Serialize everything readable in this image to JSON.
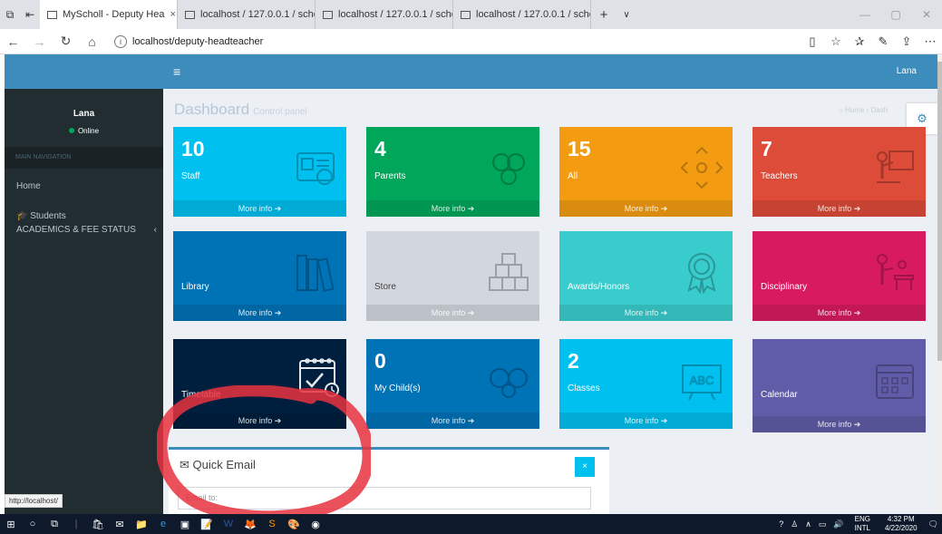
{
  "browser": {
    "tabs": [
      {
        "title": "MyScholl - Deputy Hea",
        "close": "×"
      },
      {
        "title": "localhost / 127.0.0.1 / schoc"
      },
      {
        "title": "localhost / 127.0.0.1 / schoc"
      },
      {
        "title": "localhost / 127.0.0.1 / schoc"
      }
    ],
    "new_tab": "+",
    "tab_menu": "∨",
    "window_controls": [
      "—",
      "▢",
      "✕"
    ],
    "nav": {
      "back": "←",
      "forward": "→",
      "refresh": "↻",
      "home": "⌂"
    },
    "url_info": "i",
    "url": "localhost/deputy-headteacher",
    "addr_icons": [
      "▯",
      "☆",
      "✰",
      "✎",
      "⇪",
      "⋯"
    ]
  },
  "app": {
    "hamburger": "≡",
    "top_user": "Lana",
    "sidebar": {
      "user_name": "Lana",
      "status": "Online",
      "header": "MAIN NAVIGATION",
      "items": [
        {
          "label": "Home"
        },
        {
          "label": "Students",
          "icon": "graduation-cap-icon"
        },
        {
          "label": "ACADEMICS & FEE STATUS",
          "chevron": "‹"
        }
      ]
    },
    "content": {
      "title": "Dashboard",
      "subtitle": "Control panel",
      "breadcrumb": "Home › Dash"
    },
    "boxes": [
      {
        "num": "10",
        "label": "Staff",
        "more": "More info ➔",
        "color": "#00c0ef",
        "icon": "id-card-icon"
      },
      {
        "num": "4",
        "label": "Parents",
        "more": "More info ➔",
        "color": "#00a65a",
        "icon": "family-icon"
      },
      {
        "num": "15",
        "label": "All",
        "more": "More info ➔",
        "color": "#f39c12",
        "icon": "arrows-icon"
      },
      {
        "num": "7",
        "label": "Teachers",
        "more": "More info ➔",
        "color": "#dd4b39",
        "icon": "teacher-icon"
      },
      {
        "num": "",
        "label": "Library",
        "more": "More info ➔",
        "color": "#0073b7",
        "icon": "books-icon"
      },
      {
        "num": "",
        "label": "Store",
        "more": "More info ➔",
        "color": "#d2d6de",
        "icon": "boxes-icon"
      },
      {
        "num": "",
        "label": "Awards/Honors",
        "more": "More info ➔",
        "color": "#39cccc",
        "icon": "award-icon"
      },
      {
        "num": "",
        "label": "Disciplinary",
        "more": "More info ➔",
        "color": "#d81b60",
        "icon": "discipline-icon"
      },
      {
        "num": "",
        "label": "Timetable",
        "more": "More info ➔",
        "color": "#001f3f",
        "icon": "calendar-check-icon"
      },
      {
        "num": "0",
        "label": "My Child(s)",
        "more": "More info ➔",
        "color": "#0073b7",
        "icon": "children-icon"
      },
      {
        "num": "2",
        "label": "Classes",
        "more": "More info ➔",
        "color": "#00c0ef",
        "icon": "abc-board-icon"
      },
      {
        "num": "",
        "label": "Calendar",
        "more": "More info ➔",
        "color": "#605ca8",
        "icon": "calendar-icon"
      }
    ],
    "quick_email": {
      "title": "Quick Email",
      "close": "×",
      "email_placeholder": "Email to:"
    }
  },
  "status_tip": "http://localhost/",
  "taskbar": {
    "lang": "ENG",
    "layout": "INTL",
    "time": "4:32 PM",
    "date": "4/22/2020"
  }
}
